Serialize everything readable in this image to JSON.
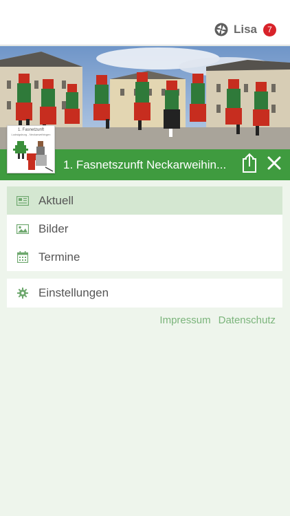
{
  "header": {
    "user_name": "Lisa",
    "notification_count": "7",
    "logo_icon": "app-logo-icon"
  },
  "club": {
    "title": "1. Fasnetszunft Neckarweihin...",
    "logo_text_line1": "1. Fasnetzunft",
    "logo_text_line2": "Ludwigsburg - Neckarweihingen",
    "share_icon": "share-icon",
    "close_icon": "close-icon"
  },
  "menu": {
    "items": [
      {
        "label": "Aktuell",
        "icon": "newspaper-icon",
        "active": true
      },
      {
        "label": "Bilder",
        "icon": "image-icon",
        "active": false
      },
      {
        "label": "Termine",
        "icon": "calendar-icon",
        "active": false
      }
    ],
    "settings": {
      "label": "Einstellungen",
      "icon": "gear-icon"
    }
  },
  "footer": {
    "impressum": "Impressum",
    "datenschutz": "Datenschutz"
  },
  "colors": {
    "accent_green": "#3f9b3f",
    "active_bg": "#d4e7d1",
    "page_bg": "#eef5ec",
    "badge_red": "#d8232a",
    "link_green": "#7bb47b"
  }
}
